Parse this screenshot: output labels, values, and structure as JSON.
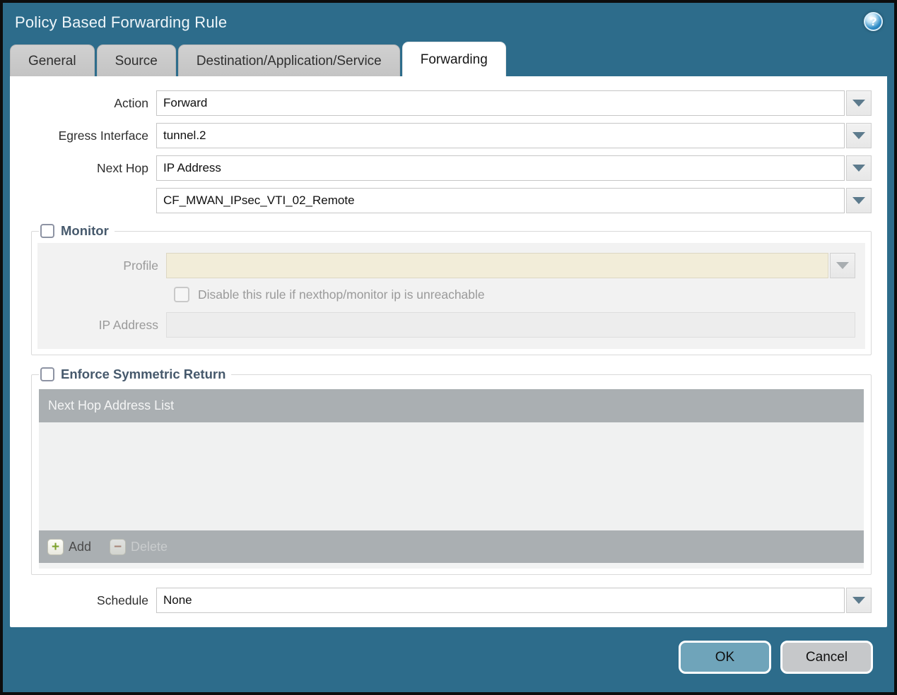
{
  "dialog": {
    "title": "Policy Based Forwarding Rule"
  },
  "icons": {
    "help": "?",
    "add_plus": "+",
    "delete_minus": "−"
  },
  "tabs": [
    {
      "label": "General"
    },
    {
      "label": "Source"
    },
    {
      "label": "Destination/Application/Service"
    },
    {
      "label": "Forwarding"
    }
  ],
  "form": {
    "action": {
      "label": "Action",
      "value": "Forward"
    },
    "egress_interface": {
      "label": "Egress Interface",
      "value": "tunnel.2"
    },
    "next_hop": {
      "label": "Next Hop",
      "value": "IP Address"
    },
    "next_hop_address": {
      "value": "CF_MWAN_IPsec_VTI_02_Remote"
    },
    "schedule": {
      "label": "Schedule",
      "value": "None"
    }
  },
  "monitor": {
    "legend": "Monitor",
    "checked": false,
    "profile": {
      "label": "Profile",
      "value": ""
    },
    "disable_rule_label": "Disable this rule if nexthop/monitor ip is unreachable",
    "disable_rule_checked": false,
    "ip_address": {
      "label": "IP Address",
      "value": ""
    }
  },
  "symmetric_return": {
    "legend": "Enforce Symmetric Return",
    "checked": false,
    "table_header": "Next Hop Address List",
    "rows": [],
    "add_label": "Add",
    "delete_label": "Delete"
  },
  "footer": {
    "ok_label": "OK",
    "cancel_label": "Cancel"
  },
  "colors": {
    "frame": "#2d6c8b",
    "ok_button": "#6fa4ba",
    "cancel_button": "#c6c8ca",
    "table_bar": "#aaafb2",
    "disabled_field": "#f2edd9"
  }
}
